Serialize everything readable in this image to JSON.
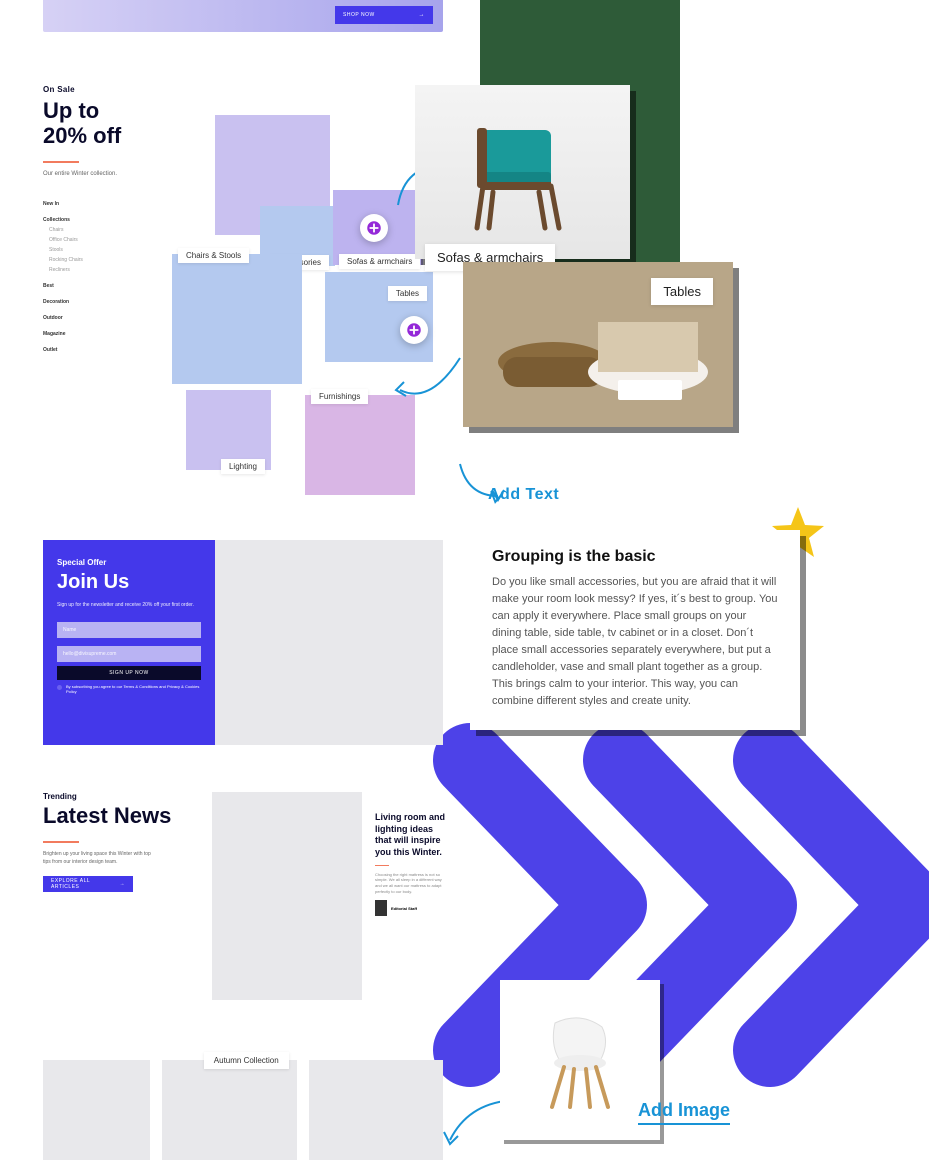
{
  "hero": {
    "cta": "SHOP NOW"
  },
  "sale": {
    "label": "On Sale",
    "headline_1": "Up to",
    "headline_2": "20% off",
    "sub": "Our entire Winter collection.",
    "nav_groups": [
      "New In",
      "Collections",
      "Best",
      "Decoration",
      "Outdoor",
      "Magazine",
      "Outlet"
    ],
    "collections_items": [
      "Chairs",
      "Office Chairs",
      "Stools",
      "Rocking Chairs",
      "Recliners"
    ]
  },
  "tiles": {
    "accessories": "Accessories",
    "chairs_stools": "Chairs & Stools",
    "sofas": "Sofas & armchairs",
    "tables": "Tables",
    "lighting": "Lighting",
    "furnishings": "Furnishings"
  },
  "chair_card": {
    "caption": "Sofas & armchairs"
  },
  "table_card": {
    "caption": "Tables"
  },
  "signup": {
    "label": "Special Offer",
    "headline": "Join Us",
    "copy": "Sign up for the newsletter and receive 20% off your first order.",
    "name_ph": "Name",
    "email_ph": "hello@divisupreme.com",
    "btn": "SIGN UP NOW",
    "terms_prefix": "By subscribing you agree to our",
    "terms_link1": "Terms & Conditions",
    "terms_mid": "and",
    "terms_link2": "Privacy & Cookies Policy"
  },
  "addtext_label": "Add Text",
  "grouping": {
    "title": "Grouping is the basic",
    "body": "Do you like small accessories, but you are afraid that it will make your room look messy? If yes, it´s best to group. You can apply it everywhere. Place small groups on your dining table, side table, tv cabinet or in a closet. Don´t place small accessories separately everywhere, but put a candleholder, vase and small plant together as a group. This brings calm to your interior. This way, you can combine different styles and create unity."
  },
  "news": {
    "label": "Trending",
    "headline": "Latest News",
    "sub": "Brighten up your living space this Winter with top tips from our interior design team.",
    "btn": "EXPLORE ALL ARTICLES",
    "article_title": "Living room and lighting ideas that will inspire you this Winter.",
    "article_body": "Choosing the right mattress is not so simple. We all sleep in a different way and we all want our mattress to adapt perfectly to our body.",
    "author": "Editorial Staff"
  },
  "strip": {
    "caption": "Autumn Collection"
  },
  "addimg_label": "Add Image",
  "colors": {
    "brand": "#4438ea",
    "accent": "#f27b5e",
    "link": "#1893d6",
    "plus": "#9428d8"
  }
}
